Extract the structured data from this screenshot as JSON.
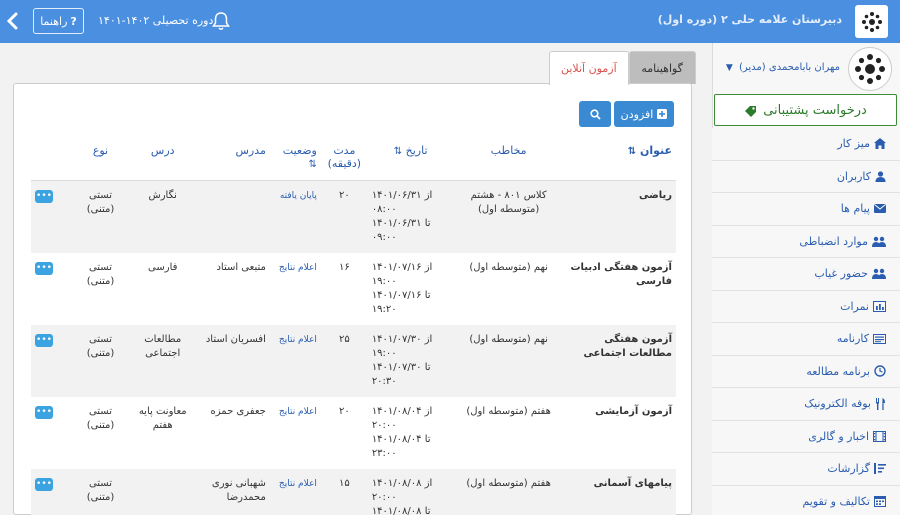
{
  "header": {
    "school_name": "دبیرستان علامه حلی ۲ (دوره اول)",
    "year_label": "دوره تحصیلی ۱۴۰۲-۱۴۰۱",
    "help_label": "راهنما",
    "help_icon": "question-icon",
    "bell_icon": "bell-icon",
    "back_icon": "chevron-left-icon",
    "bar_color": "#4a8fe0"
  },
  "sidebar": {
    "user_name": "مهران بابامحمدی (مدیر)",
    "support_label": "درخواست پشتیبانی",
    "items": [
      {
        "label": "میز کار",
        "icon": "home-icon"
      },
      {
        "label": "کاربران",
        "icon": "user-icon"
      },
      {
        "label": "پیام ها",
        "icon": "envelope-icon"
      },
      {
        "label": "موارد انضباطی",
        "icon": "users-icon"
      },
      {
        "label": "حضور غیاب",
        "icon": "users-icon"
      },
      {
        "label": "نمرات",
        "icon": "bar-chart-icon"
      },
      {
        "label": "کارنامه",
        "icon": "id-card-icon"
      },
      {
        "label": "برنامه مطالعه",
        "icon": "clock-icon"
      },
      {
        "label": "بوفه الکترونیک",
        "icon": "utensils-icon"
      },
      {
        "label": "اخبار و گالری",
        "icon": "film-icon"
      },
      {
        "label": "گزارشات",
        "icon": "sort-icon"
      },
      {
        "label": "تکالیف و تقویم",
        "icon": "calendar-icon"
      }
    ]
  },
  "tabs": [
    {
      "label": "آزمون آنلاین",
      "active": true
    },
    {
      "label": "گواهینامه",
      "active": false
    }
  ],
  "toolbar": {
    "add_label": "افزودن",
    "add_icon": "plus-square-icon",
    "search_icon": "search-icon"
  },
  "table": {
    "headers": {
      "title": "عنوان",
      "audience": "مخاطب",
      "date": "تاریخ",
      "duration": "مدت (دقیقه)",
      "status": "وضعیت",
      "teacher": "مدرس",
      "subject": "درس",
      "type": "نوع"
    },
    "rows": [
      {
        "title": "ریاضی",
        "audience": "کلاس ۸۰۱ - هشتم (متوسطه اول)",
        "from": "از ۱۴۰۱/۰۶/۳۱",
        "from_time": "۰۸:۰۰",
        "to": "تا ۱۴۰۱/۰۶/۳۱",
        "to_time": "۰۹:۰۰",
        "duration": "۲۰",
        "status": "پایان یافته",
        "teacher": "",
        "subject": "نگارش",
        "type": "تستی (متنی)"
      },
      {
        "title": "آزمون هفتگی ادبیات فارسی",
        "audience": "نهم (متوسطه اول)",
        "from": "از ۱۴۰۱/۰۷/۱۶",
        "from_time": "۱۹:۰۰",
        "to": "تا ۱۴۰۱/۰۷/۱۶",
        "to_time": "۱۹:۲۰",
        "duration": "۱۶",
        "status": "اعلام نتایج",
        "teacher": "متبعی استاد",
        "subject": "فارسی",
        "type": "تستی (متنی)"
      },
      {
        "title": "آزمون هفتگی مطالعات اجتماعی",
        "audience": "نهم (متوسطه اول)",
        "from": "از ۱۴۰۱/۰۷/۳۰",
        "from_time": "۱۹:۰۰",
        "to": "تا ۱۴۰۱/۰۷/۳۰",
        "to_time": "۲۰:۳۰",
        "duration": "۲۵",
        "status": "اعلام نتایج",
        "teacher": "افسریان استاد",
        "subject": "مطالعات اجتماعی",
        "type": "تستی (متنی)"
      },
      {
        "title": "آزمون آزمایشی",
        "audience": "هفتم (متوسطه اول)",
        "from": "از ۱۴۰۱/۰۸/۰۴",
        "from_time": "۲۰:۰۰",
        "to": "تا ۱۴۰۱/۰۸/۰۴",
        "to_time": "۲۳:۰۰",
        "duration": "۲۰",
        "status": "اعلام نتایج",
        "teacher": "جعفری حمزه",
        "subject": "معاونت پایه هفتم",
        "type": "تستی (متنی)"
      },
      {
        "title": "پیامهای آسمانی",
        "audience": "هفتم (متوسطه اول)",
        "from": "از ۱۴۰۱/۰۸/۰۸",
        "from_time": "۲۰:۰۰",
        "to": "تا ۱۴۰۱/۰۸/۰۸",
        "to_time": "",
        "duration": "۱۵",
        "status": "اعلام نتایج",
        "teacher": "شهبانی نوری محمدرضا",
        "subject": "",
        "type": "تستی (متنی)"
      }
    ]
  },
  "colors": {
    "accent": "#3a8ad3",
    "link": "#2a5db0",
    "support_green": "#2c7a2c",
    "active_tab": "#d9534f"
  }
}
